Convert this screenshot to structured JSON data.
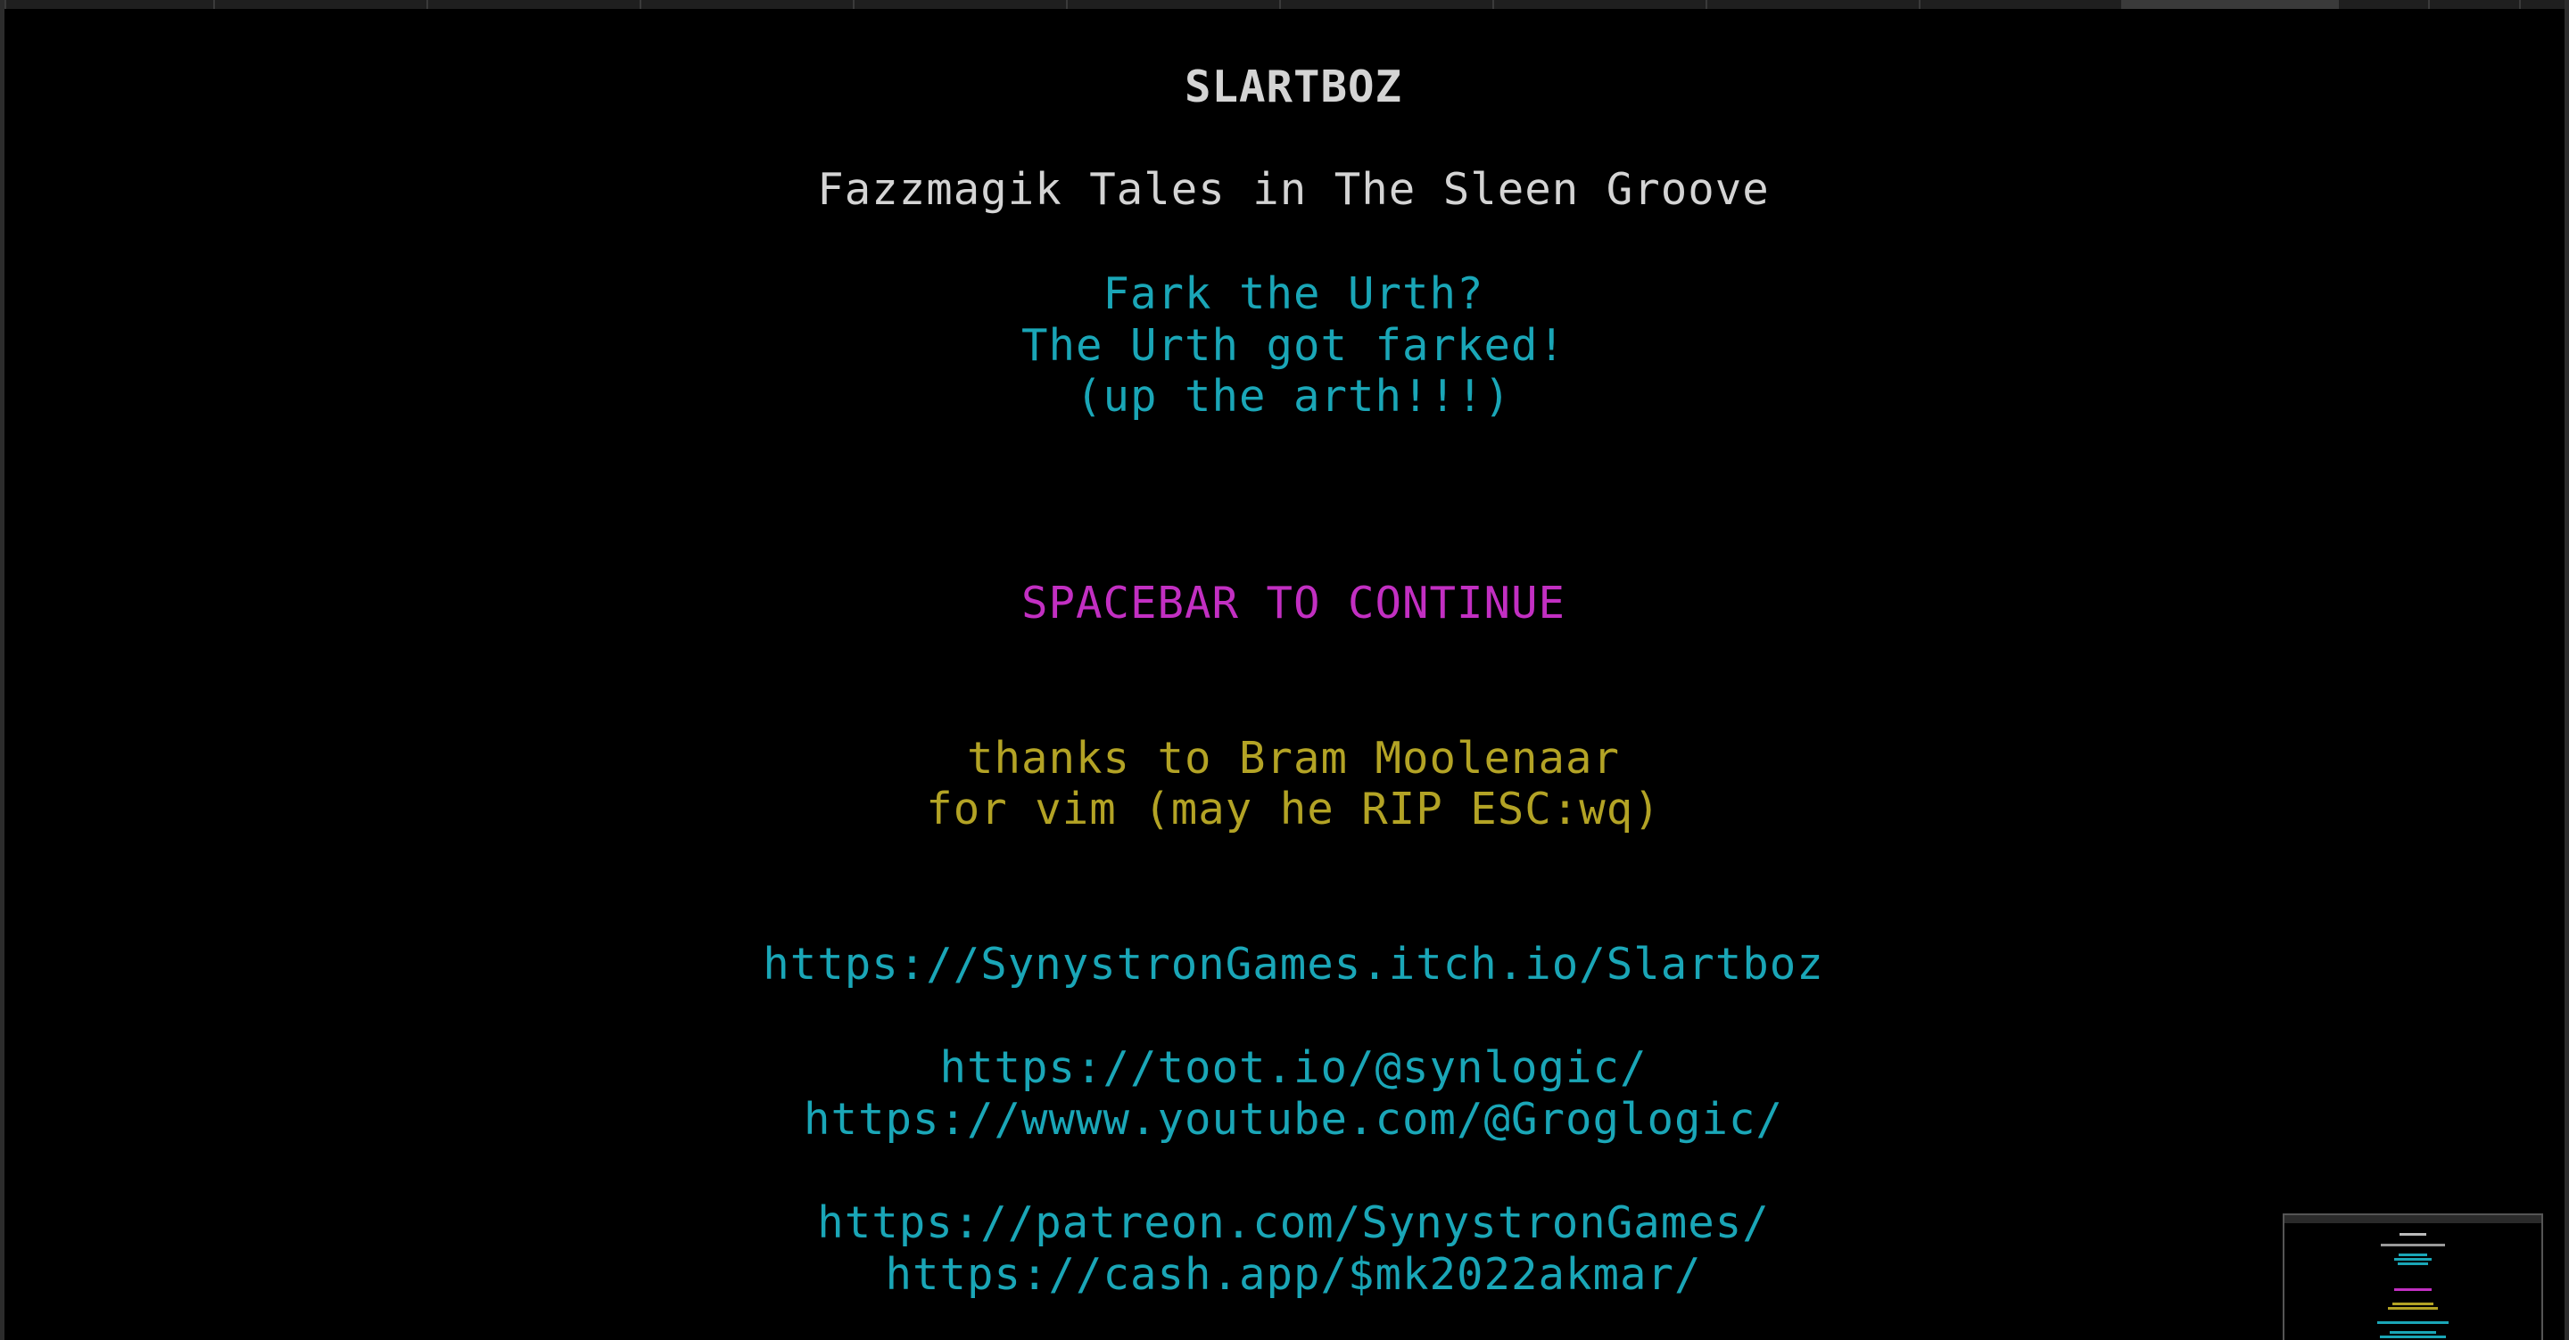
{
  "game": {
    "title": "SLARTBOZ",
    "subtitle": "Fazzmagik Tales in The Sleen Groove",
    "tagline": [
      "Fark the Urth?",
      "The Urth got farked!",
      "(up the arth!!!)"
    ],
    "prompt": "SPACEBAR TO CONTINUE",
    "thanks": [
      "thanks to Bram Moolenaar",
      "for vim (may he RIP ESC:wq)"
    ],
    "links": {
      "itch": "https://SynystronGames.itch.io/Slartboz",
      "toot": "https://toot.io/@synlogic/",
      "youtube": "https://wwww.youtube.com/@Groglogic/",
      "patreon": "https://patreon.com/SynystronGames/",
      "cashapp": "https://cash.app/$mk2022akmar/"
    }
  },
  "colors": {
    "background": "#000000",
    "title": "#d4d4d4",
    "cyan": "#1aa6b7",
    "magenta": "#c22fc2",
    "olive": "#b3a325"
  }
}
